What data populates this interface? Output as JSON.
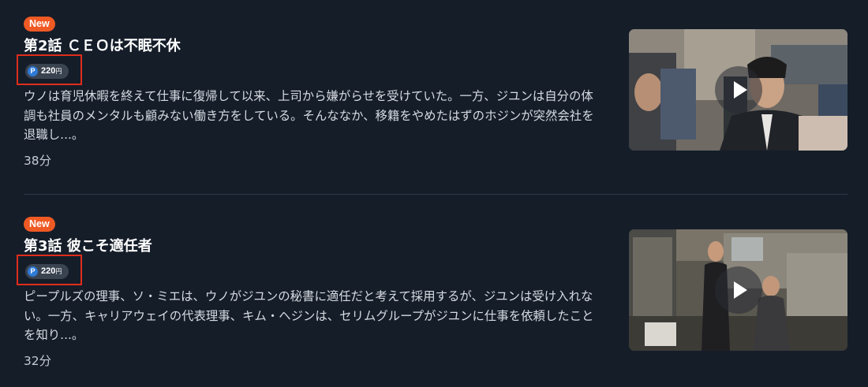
{
  "episodes": [
    {
      "badge": "New",
      "title": "第2話 ＣＥＯは不眠不休",
      "price": "220",
      "price_unit": "円",
      "description": "ウノは育児休暇を終えて仕事に復帰して以来、上司から嫌がらせを受けていた。一方、ジユンは自分の体調も社員のメンタルも顧みない働き方をしている。そんななか、移籍をやめたはずのホジンが突然会社を退職し...。",
      "duration": "38分",
      "thumbnail_icon": "play-icon"
    },
    {
      "badge": "New",
      "title": "第3話 彼こそ適任者",
      "price": "220",
      "price_unit": "円",
      "description": "ピープルズの理事、ソ・ミエは、ウノがジユンの秘書に適任だと考えて採用するが、ジユンは受け入れない。一方、キャリアウェイの代表理事、キム・ヘジンは、セリムグループがジユンに仕事を依頼したことを知り...。",
      "duration": "32分",
      "thumbnail_icon": "play-icon"
    }
  ],
  "point_icon_label": "P",
  "colors": {
    "background": "#151d29",
    "new_badge": "#ef5a24",
    "highlight_box": "#e02d1b",
    "point_icon": "#2e7ad6",
    "price_pill": "#3a4350",
    "divider": "#2e3846"
  }
}
